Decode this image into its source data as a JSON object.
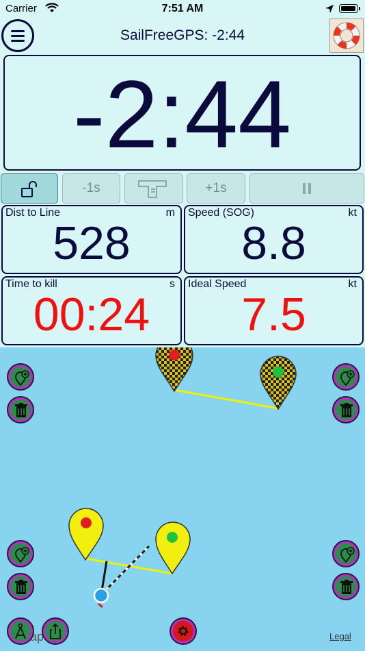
{
  "status_bar": {
    "carrier": "Carrier",
    "time": "7:51 AM"
  },
  "nav": {
    "title": "SailFreeGPS: -2:44"
  },
  "timer": {
    "value": "-2:44"
  },
  "controls": {
    "minus_label": "-1s",
    "plus_label": "+1s"
  },
  "panels": {
    "dist": {
      "label": "Dist to Line",
      "unit": "m",
      "value": "528"
    },
    "speed": {
      "label": "Speed (SOG)",
      "unit": "kt",
      "value": "8.8"
    },
    "time_to_kill": {
      "label": "Time to kill",
      "unit": "s",
      "value": "00:24"
    },
    "ideal_speed": {
      "label": "Ideal Speed",
      "unit": "kt",
      "value": "7.5"
    }
  },
  "map": {
    "legal_label": "Legal",
    "partial_label": "ap"
  },
  "colors": {
    "accent": "#0a0a3c",
    "warning": "#ef1010",
    "map_water": "#86d4f0",
    "button": "#b72bd6",
    "line": "#f0f000"
  }
}
